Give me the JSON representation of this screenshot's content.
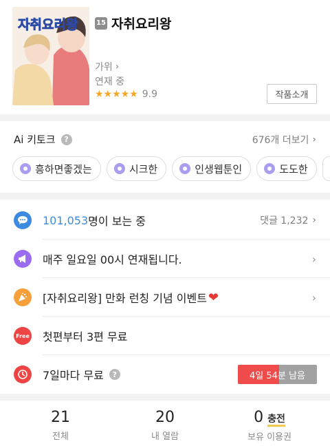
{
  "header": {
    "age_rating": "15",
    "title": "자취요리왕",
    "cover_title_text": "자취요리왕",
    "author": "가위",
    "author_chevron": "›",
    "status": "연재 중",
    "stars": "★★★★★",
    "rating": "9.9",
    "intro_button": "작품소개"
  },
  "keywords": {
    "title": "Ai 키토크",
    "help": "?",
    "more": "676개 더보기",
    "more_chevron": "›",
    "chips": [
      "흥하면좋겠는",
      "시크한",
      "인생웹툰인",
      "도도한"
    ]
  },
  "info": {
    "viewers_count": "101,053",
    "viewers_suffix": "명이 보는 중",
    "comments": "댓글 1,232",
    "schedule": "매주 일요일 00시 연재됩니다.",
    "event": "[자취요리왕] 만화 런칭 기념 이벤트",
    "heart": "❤",
    "free_badge": "Free",
    "free_text": "첫편부터 3편 무료",
    "wait_free": "7일마다 무료",
    "wait_help": "?",
    "timer": "4일 54분 남음",
    "timer_progress": 0.52,
    "chevron": "›"
  },
  "stats": {
    "total_num": "21",
    "total_label": "전체",
    "read_num": "20",
    "read_label": "내 열람",
    "owned_num": "0",
    "charge": "충전",
    "owned_label": "보유 이용권"
  },
  "colors": {
    "accent_blue": "#3d8be0",
    "timer_red": "#f04b4b",
    "star": "#f5a623",
    "keyword_purple": "#a99df0"
  }
}
